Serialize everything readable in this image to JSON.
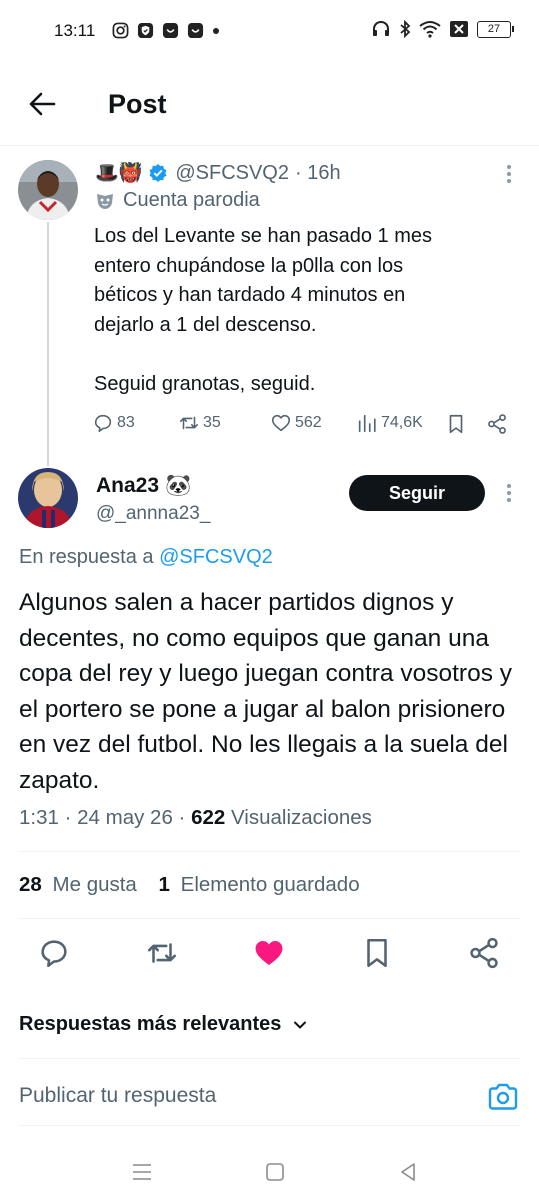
{
  "status_bar": {
    "time": "13:11",
    "battery": "27"
  },
  "header": {
    "title": "Post"
  },
  "parent_tweet": {
    "emoji": "🎩👹",
    "handle": "@SFCSVQ2",
    "time": "· 16h",
    "parody_label": "Cuenta parodia",
    "text": "Los del Levante se han pasado 1 mes\nentero chupándose la p0lla con los\nbéticos y han tardado 4 minutos en\ndejarlo a 1 del descenso.\n\nSeguid granotas, seguid.",
    "replies": "83",
    "reposts": "35",
    "likes": "562",
    "views": "74,6K"
  },
  "reply_tweet": {
    "name": "Ana23",
    "name_emoji": "🐼",
    "handle": "@_annna23_",
    "follow_label": "Seguir",
    "replying_prefix": "En respuesta a",
    "replying_to": "@SFCSVQ2",
    "text": "Algunos salen a hacer partidos dignos y decentes, no como equipos que ganan una copa del rey y luego juegan contra vosotros y el portero se pone a jugar al balon prisionero en vez del futbol. No les llegais a la suela del zapato.",
    "time_date": "1:31 · 24 may 26 ·",
    "views_count": "622",
    "views_label": "Visualizaciones",
    "likes_count": "28",
    "likes_label": "Me gusta",
    "saved_count": "1",
    "saved_label": "Elemento guardado"
  },
  "sort_label": "Respuestas más relevantes",
  "reply_placeholder": "Publicar tu respuesta",
  "colors": {
    "accent": "#1d9bf0",
    "like_active": "#f91880",
    "text": "#0f1419",
    "secondary": "#536471"
  }
}
